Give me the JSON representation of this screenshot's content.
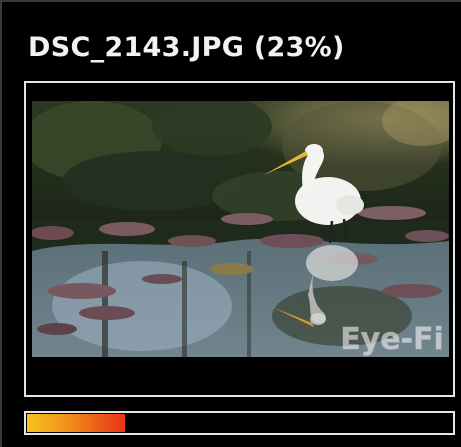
{
  "window": {
    "title": "DSC_2143.JPG (23%)"
  },
  "photo": {
    "description": "Egret standing in pond with lily pads",
    "watermark": "Eye-Fi"
  },
  "upload": {
    "progress_percent": 23,
    "fill_colors": [
      "#f4c21e",
      "#e8341a"
    ]
  }
}
